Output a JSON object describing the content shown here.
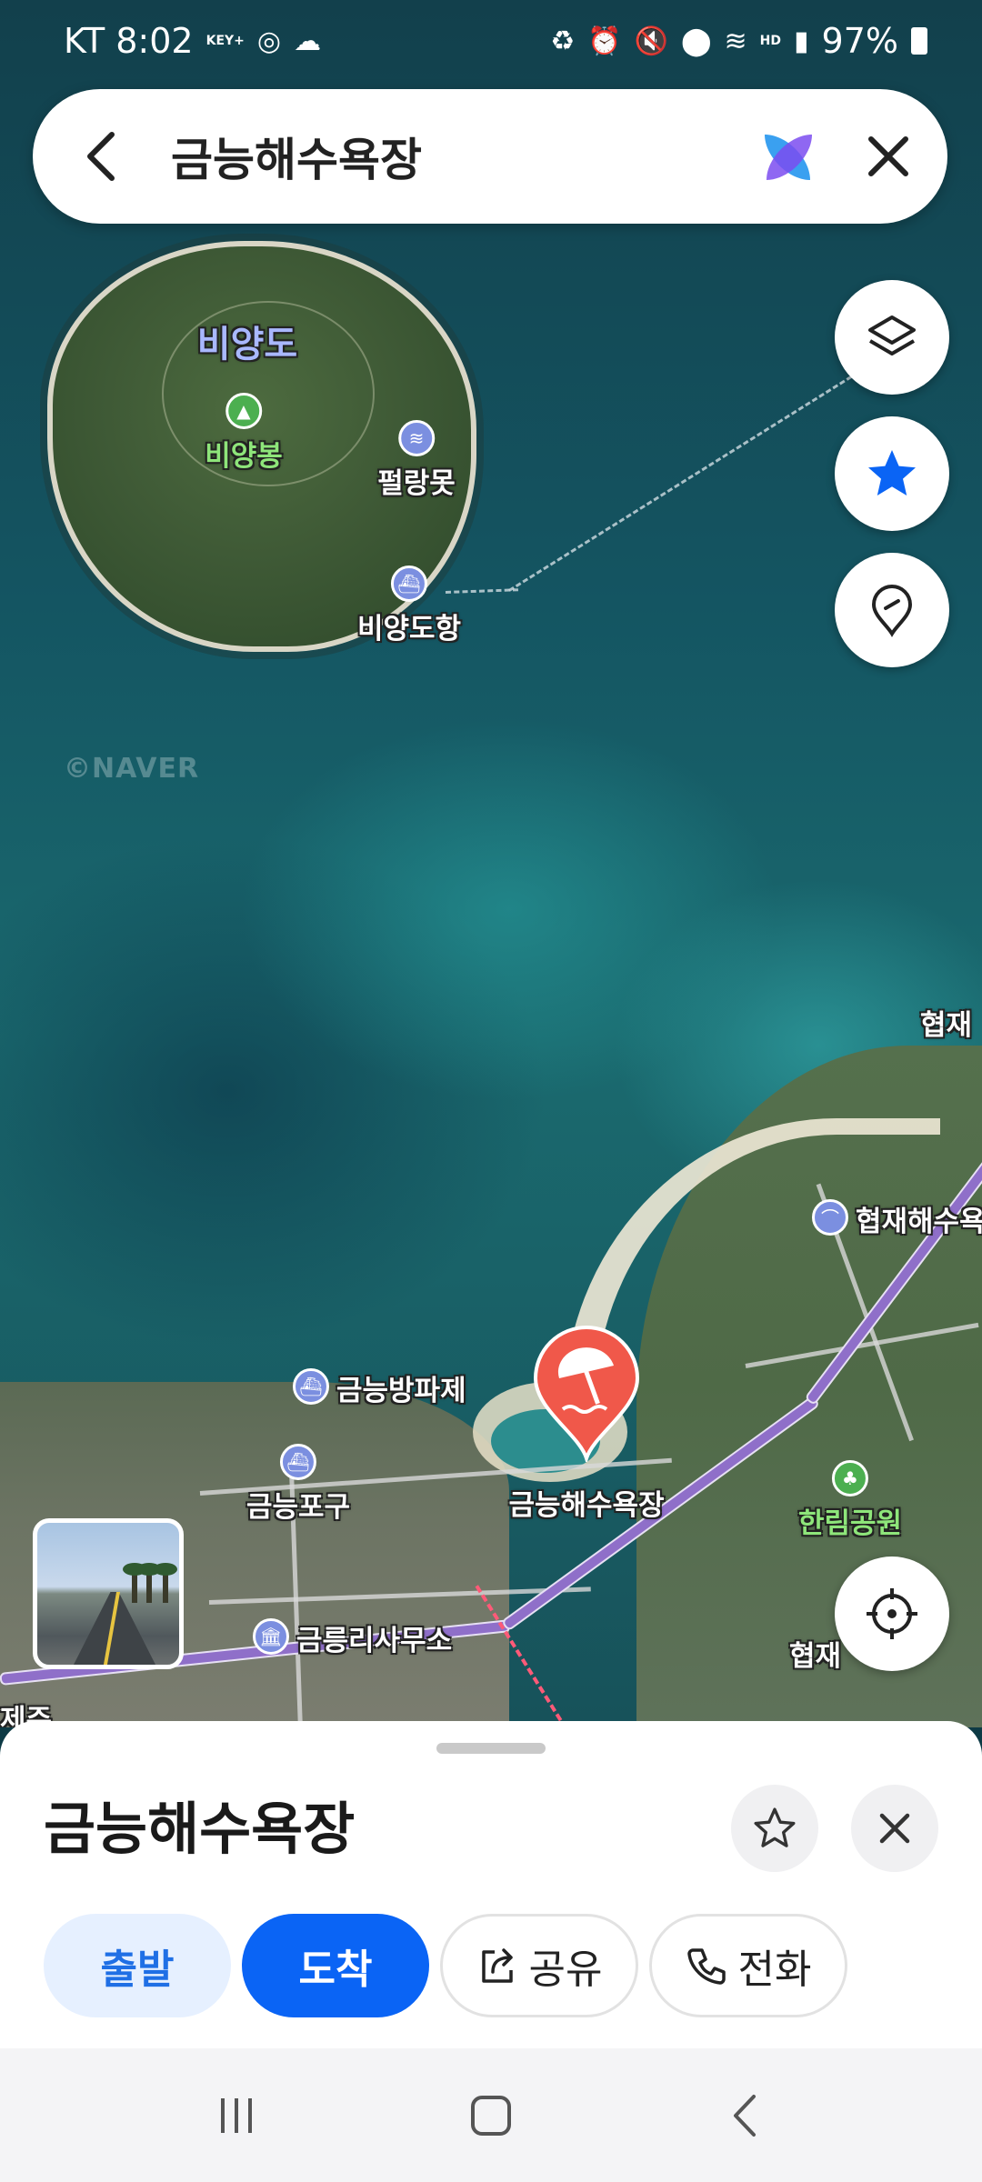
{
  "status_bar": {
    "carrier_time": "KT 8:02",
    "key_badge": "KEY+",
    "battery": "97%",
    "icons_left": [
      "instagram-icon",
      "cloud-icon"
    ],
    "icons_right": [
      "recycle-icon",
      "alarm-icon",
      "mute-icon",
      "location-icon",
      "wifi-icon",
      "hd-icon",
      "signal-icon",
      "battery-icon"
    ]
  },
  "search": {
    "query": "금능해수욕장",
    "back_icon": "back-arrow-icon",
    "ai_icon": "ai-logo-icon",
    "clear_icon": "close-icon"
  },
  "map_controls": [
    "layers-icon",
    "favorite-star-icon",
    "place-pin-icon",
    "current-location-icon"
  ],
  "map": {
    "watermark": "©NAVER",
    "labels": {
      "island": "비양도",
      "peak": "비양봉",
      "spot1": "펄랑못",
      "port1": "비양도항",
      "breakwater": "금능방파제",
      "port2": "금능포구",
      "office": "금릉리사무소",
      "beach": "금능해수욕장",
      "park": "한림공원",
      "hyeopjae": "협재",
      "hyeopjae_beach": "협재해수욕",
      "hyeopjae_partial": "협재",
      "left_edge": "제주"
    },
    "selected_pin_icon": "beach-umbrella-icon"
  },
  "sheet": {
    "title": "금능해수욕장",
    "favorite_icon": "star-outline-icon",
    "close_icon": "close-icon",
    "buttons": {
      "start": "출발",
      "arrive": "도착",
      "share": "공유",
      "call": "전화"
    }
  },
  "colors": {
    "primary": "#0a64f5",
    "primary_soft": "#e6f0ff",
    "pin": "#f0584a",
    "route": "#8f6fc9"
  }
}
